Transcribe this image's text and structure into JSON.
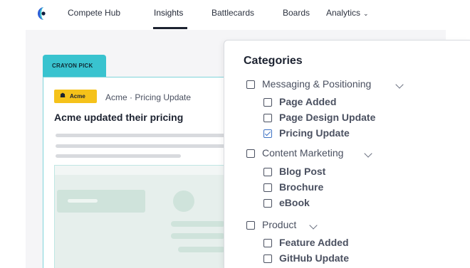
{
  "nav": {
    "items": [
      {
        "label": "Compete Hub"
      },
      {
        "label": "Insights"
      },
      {
        "label": "Battlecards"
      },
      {
        "label": "Boards"
      },
      {
        "label": "Analytics"
      }
    ],
    "active": "Insights"
  },
  "card": {
    "tag": "CRAYON PICK",
    "competitor": "Acme",
    "subtitle": "Acme · Pricing Update",
    "title": "Acme updated their pricing"
  },
  "categories": {
    "title": "Categories",
    "groups": [
      {
        "label": "Messaging & Positioning",
        "checked": false,
        "items": [
          {
            "label": "Page Added",
            "checked": false
          },
          {
            "label": "Page Design Update",
            "checked": false
          },
          {
            "label": "Pricing Update",
            "checked": true
          }
        ]
      },
      {
        "label": "Content Marketing",
        "checked": false,
        "items": [
          {
            "label": "Blog Post",
            "checked": false
          },
          {
            "label": "Brochure",
            "checked": false
          },
          {
            "label": "eBook",
            "checked": false
          }
        ]
      },
      {
        "label": "Product",
        "checked": false,
        "items": [
          {
            "label": "Feature Added",
            "checked": false
          },
          {
            "label": "GitHub Update",
            "checked": false
          }
        ]
      }
    ]
  },
  "colors": {
    "accent": "#39c3cf",
    "badge": "#f5c21a",
    "checkbox_checked": "#3d72c4"
  }
}
